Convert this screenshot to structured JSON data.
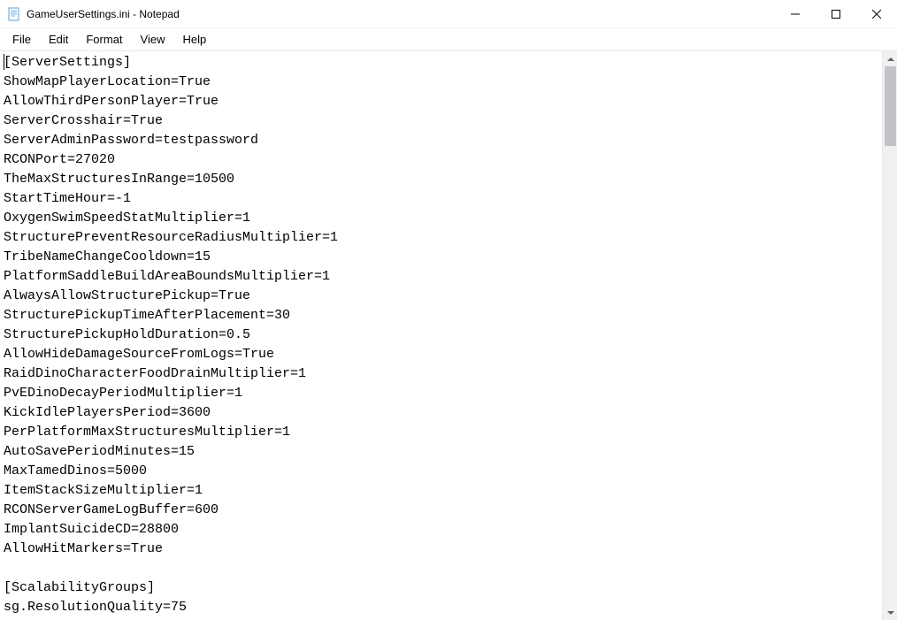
{
  "window": {
    "title": "GameUserSettings.ini - Notepad"
  },
  "menu": {
    "file": "File",
    "edit": "Edit",
    "format": "Format",
    "view": "View",
    "help": "Help"
  },
  "editor": {
    "content": "[ServerSettings]\nShowMapPlayerLocation=True\nAllowThirdPersonPlayer=True\nServerCrosshair=True\nServerAdminPassword=testpassword\nRCONPort=27020\nTheMaxStructuresInRange=10500\nStartTimeHour=-1\nOxygenSwimSpeedStatMultiplier=1\nStructurePreventResourceRadiusMultiplier=1\nTribeNameChangeCooldown=15\nPlatformSaddleBuildAreaBoundsMultiplier=1\nAlwaysAllowStructurePickup=True\nStructurePickupTimeAfterPlacement=30\nStructurePickupHoldDuration=0.5\nAllowHideDamageSourceFromLogs=True\nRaidDinoCharacterFoodDrainMultiplier=1\nPvEDinoDecayPeriodMultiplier=1\nKickIdlePlayersPeriod=3600\nPerPlatformMaxStructuresMultiplier=1\nAutoSavePeriodMinutes=15\nMaxTamedDinos=5000\nItemStackSizeMultiplier=1\nRCONServerGameLogBuffer=600\nImplantSuicideCD=28800\nAllowHitMarkers=True\n\n[ScalabilityGroups]\nsg.ResolutionQuality=75"
  }
}
